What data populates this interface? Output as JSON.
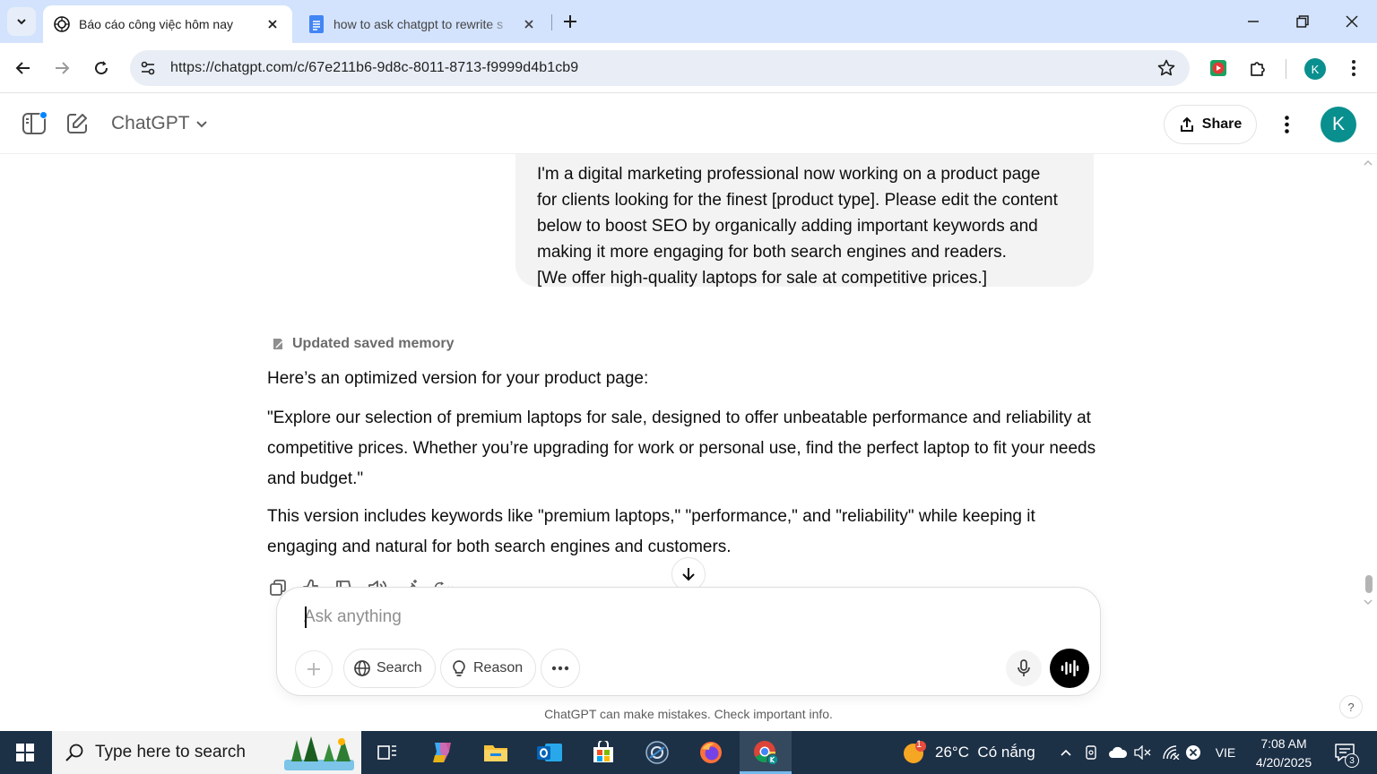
{
  "browser": {
    "tabs": [
      {
        "title": "Báo cáo công việc hôm nay",
        "active": true,
        "favicon": "openai-icon"
      },
      {
        "title": "how to ask chatgpt to rewrite s",
        "active": false,
        "favicon": "google-docs-icon"
      }
    ],
    "url": "https://chatgpt.com/c/67e211b6-9d8c-8011-8713-f9999d4b1cb9",
    "profile_initial": "K"
  },
  "app": {
    "model_name": "ChatGPT",
    "share_label": "Share",
    "avatar_initial": "K"
  },
  "conversation": {
    "user_message_lines": [
      "I'm a digital marketing professional now working on a product page",
      "for clients looking for the finest [product type]. Please edit the content",
      "below to boost SEO by organically adding important keywords and",
      "making it more engaging for both search engines and readers.",
      "[We offer high-quality laptops for sale at competitive prices.]"
    ],
    "memory_label": "Updated saved memory",
    "assistant_paragraphs": [
      "Here’s an optimized version for your product page:",
      "\"Explore our selection of premium laptops for sale, designed to offer unbeatable performance and reliability at competitive prices. Whether you’re upgrading for work or personal use, find the perfect laptop to fit your needs and budget.\"",
      "This version includes keywords like \"premium laptops,\" \"performance,\" and \"reliability\" while keeping it engaging and natural for both search engines and customers."
    ]
  },
  "composer": {
    "placeholder": "Ask anything",
    "search_label": "Search",
    "reason_label": "Reason"
  },
  "disclaimer": "ChatGPT can make mistakes. Check important info.",
  "help_label": "?",
  "taskbar": {
    "search_placeholder": "Type here to search",
    "weather_badge": "1",
    "weather": "26°C  Có nắng",
    "language": "VIE",
    "time": "7:08 AM",
    "date": "4/20/2025",
    "notification_count": "3"
  },
  "colors": {
    "tabstrip": "#d3e3fd",
    "accent_avatar": "#0a8f8f",
    "taskbar": "#1c3046",
    "user_bubble": "#f3f3f3"
  }
}
